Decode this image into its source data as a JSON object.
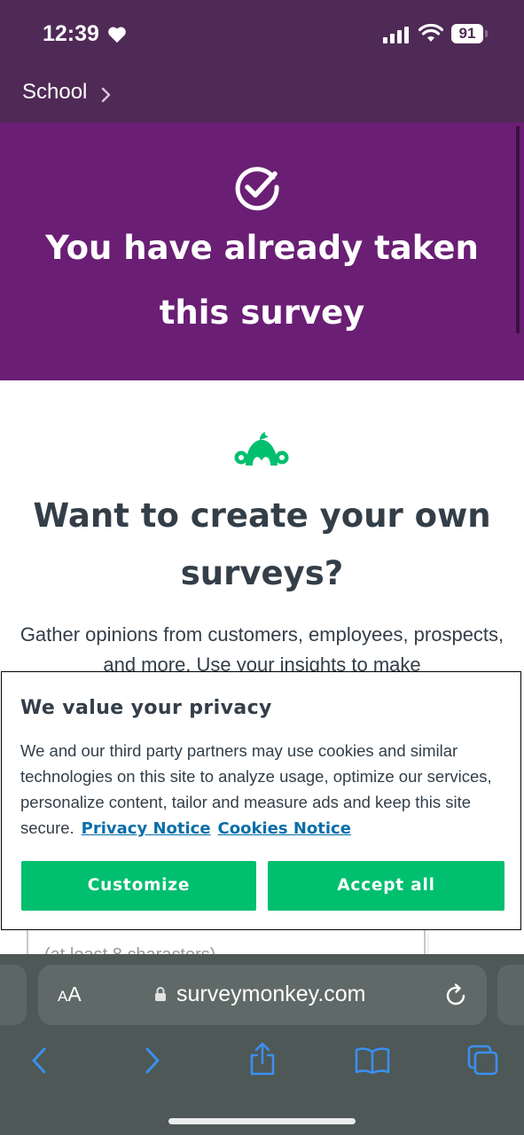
{
  "status_bar": {
    "time": "12:39",
    "battery": "91",
    "icons": [
      "heart-icon",
      "signal-icon",
      "wifi-icon",
      "battery-icon"
    ]
  },
  "back_nav": {
    "label": "School"
  },
  "banner": {
    "title": "You have already taken this survey",
    "icon": "check-circle-icon",
    "color": "#6a1e74"
  },
  "promo": {
    "icon": "surveymonkey-logo-icon",
    "title": "Want to create your own surveys?",
    "text": "Gather opinions from customers, employees, prospects, and more. Use your insights to make"
  },
  "form": {
    "hint": "(at least 8 characters)"
  },
  "privacy": {
    "title": "We value your privacy",
    "body": "We and our third party partners may use cookies and similar technologies on this site to analyze usage, optimize our services, personalize content, tailor and measure ads and keep this site secure.",
    "privacy_link": "Privacy Notice",
    "cookies_link": "Cookies Notice",
    "customize_label": "Customize",
    "accept_label": "Accept all",
    "button_color": "#00bf6f",
    "link_color": "#0a6ea8"
  },
  "browser": {
    "text_size_label": "AA",
    "url": "surveymonkey.com",
    "nav_icons": [
      "back-arrow-icon",
      "forward-arrow-icon",
      "share-icon",
      "bookmarks-icon",
      "tabs-icon"
    ]
  }
}
